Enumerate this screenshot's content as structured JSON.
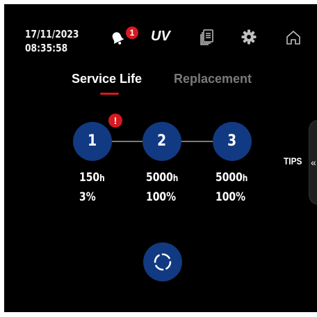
{
  "header": {
    "date": "17/11/2023",
    "time": "08:35:58",
    "notification_count": "1",
    "uv_label": "UV",
    "icons": [
      "bell-icon",
      "document-icon",
      "gear-icon",
      "home-icon"
    ]
  },
  "tabs": [
    {
      "label": "Service Life",
      "active": true
    },
    {
      "label": "Replacement",
      "active": false
    }
  ],
  "steps": [
    {
      "number": "1",
      "hours": "150",
      "unit": "h",
      "percent": "3%",
      "warning": "!"
    },
    {
      "number": "2",
      "hours": "5000",
      "unit": "h",
      "percent": "100%"
    },
    {
      "number": "3",
      "hours": "5000",
      "unit": "h",
      "percent": "100%"
    }
  ],
  "tips": {
    "label": "TIPS",
    "arrow": "«"
  },
  "actions": {
    "refresh_icon": "refresh-icon"
  },
  "colors": {
    "background": "#000000",
    "accent_blue": "#123a82",
    "alert_red": "#d71920",
    "inactive_text": "#7a7a7a"
  }
}
